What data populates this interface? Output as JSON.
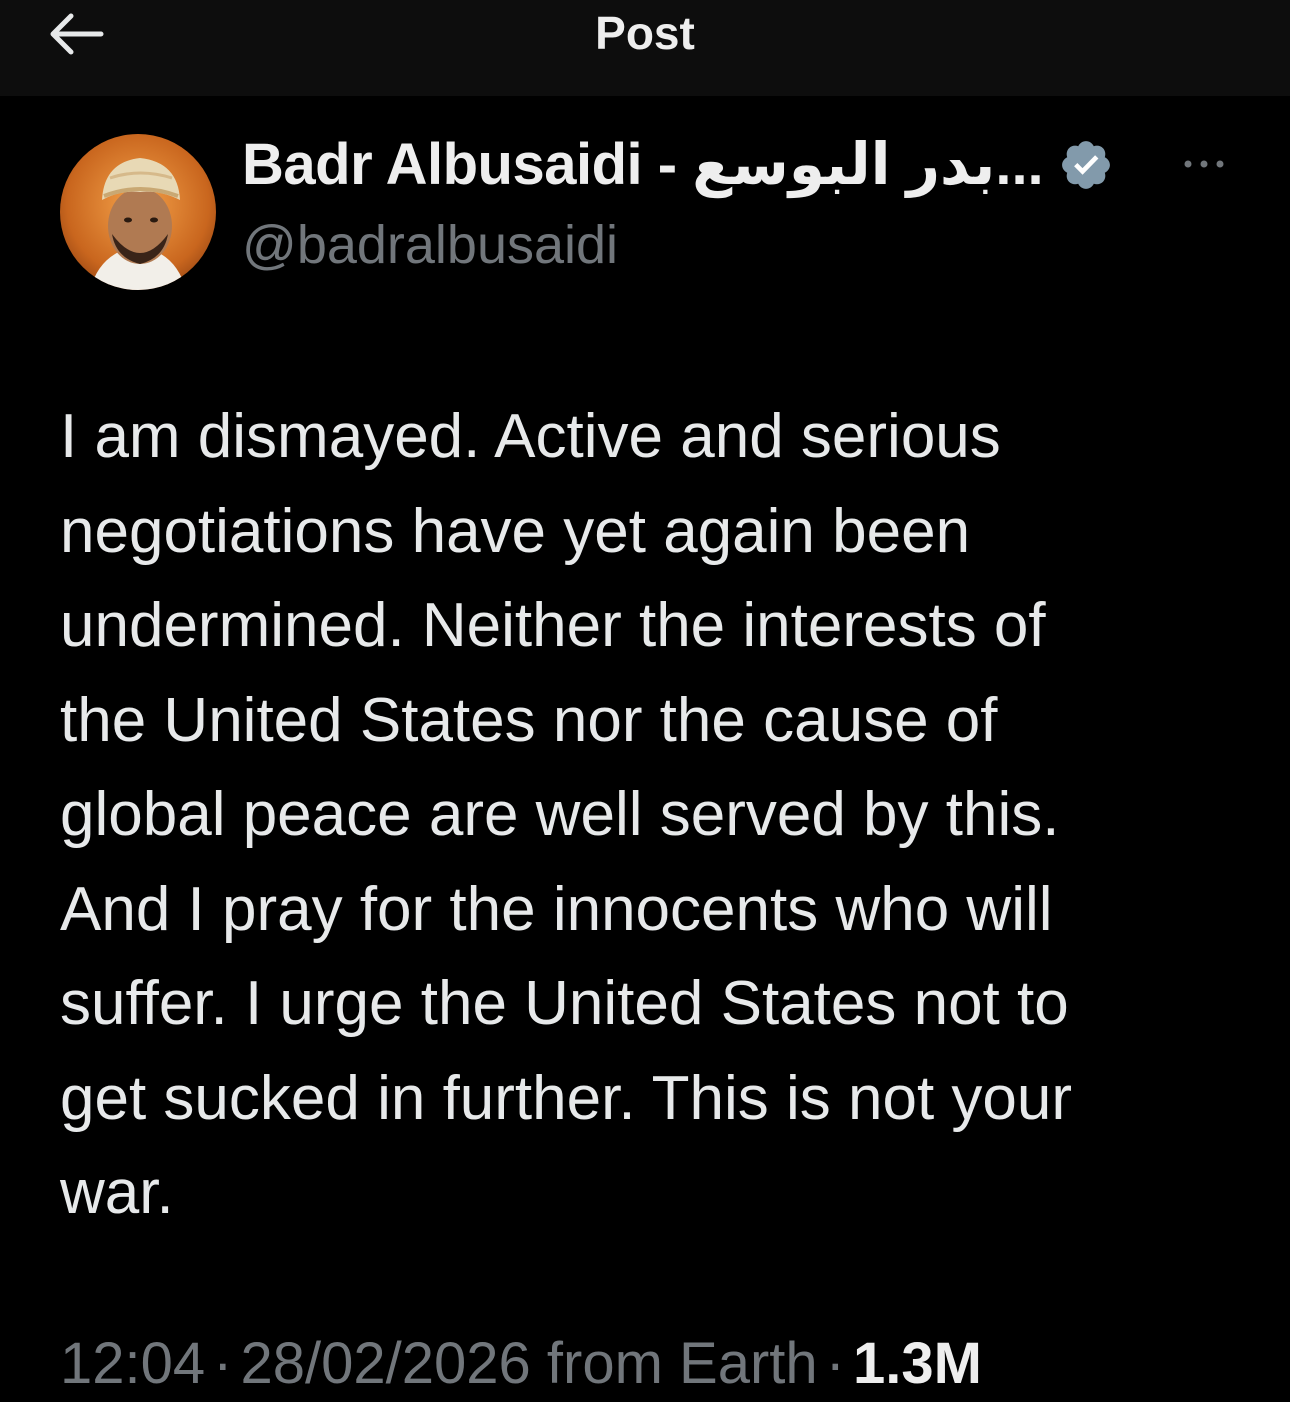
{
  "header": {
    "title": "Post",
    "back_icon": "arrow-left-icon"
  },
  "author": {
    "display_name": "Badr Albusaidi - بدر البوسع...",
    "handle": "@badralbusaidi",
    "verified_icon": "verified-badge-icon",
    "verified_color": "#829aab",
    "more_icon": "more-dots-icon"
  },
  "post": {
    "lines": [
      "I am dismayed. Active and serious",
      "negotiations have yet again been",
      "undermined. Neither the interests of",
      "the United States nor the cause of",
      "global peace are well served by this.",
      "And I pray for the innocents who will",
      "suffer. I urge the United States not to",
      "get sucked in further. This is not your",
      "war."
    ]
  },
  "meta": {
    "time": "12:04",
    "separator": "·",
    "date": "28/02/2026",
    "location": "from Earth",
    "views": "1.3M"
  },
  "colors": {
    "background": "#000000",
    "header_background": "#0d0d0d",
    "text": "#e7e9ea",
    "secondary_text": "#71767b"
  }
}
